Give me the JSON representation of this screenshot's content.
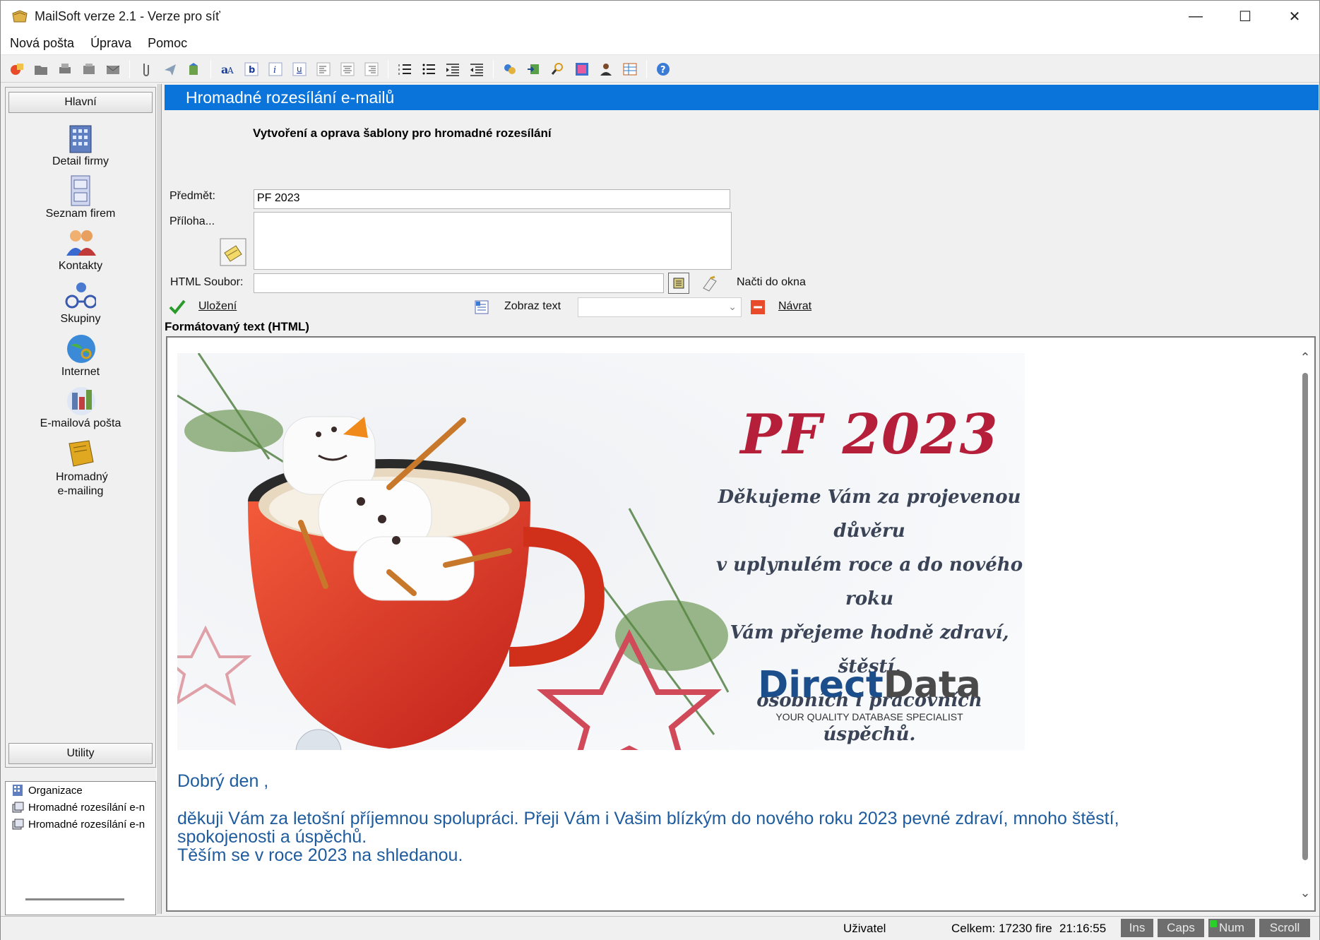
{
  "window": {
    "title": "MailSoft verze 2.1 - Verze pro síť",
    "minimize": "—",
    "maximize": "☐",
    "close": "✕"
  },
  "menu": {
    "items": [
      "Nová pošta",
      "Úprava",
      "Pomoc"
    ]
  },
  "toolbar": {
    "icons": [
      "new-mail-icon",
      "open-icon",
      "print-icon",
      "print-preview-icon",
      "mail-icon",
      "attach-icon",
      "send-icon",
      "export-icon",
      "font-icon",
      "bold-icon",
      "italic-icon",
      "underline-icon",
      "align-left-icon",
      "align-center-icon",
      "align-right-icon",
      "numbered-list-icon",
      "bullet-list-icon",
      "indent-icon",
      "outdent-icon",
      "color-icon",
      "import-icon",
      "search-icon",
      "image-icon",
      "user-icon",
      "table-icon",
      "help-icon"
    ]
  },
  "leftnav": {
    "group_main": "Hlavní",
    "group_utility": "Utility",
    "items": [
      {
        "label": "Detail firmy",
        "icon": "building-icon"
      },
      {
        "label": "Seznam firem",
        "icon": "cabinet-icon"
      },
      {
        "label": "Kontakty",
        "icon": "contacts-icon"
      },
      {
        "label": "Skupiny",
        "icon": "groups-icon"
      },
      {
        "label": "Internet",
        "icon": "globe-icon"
      },
      {
        "label": "E-mailová pošta",
        "icon": "email-icon"
      },
      {
        "label": "Hromadný e-mailing",
        "icon": "book-icon"
      }
    ]
  },
  "tree": {
    "items": [
      "Organizace",
      "Hromadné rozesílání e-n",
      "Hromadné rozesílání e-n"
    ]
  },
  "main": {
    "header": "Hromadné rozesílání e-mailů",
    "subheading": "Vytvoření a oprava šablony pro hromadné rozesílání",
    "subject_label": "Předmět:",
    "subject_value": "PF 2023",
    "attachment_label": "Příloha...",
    "html_file_label": "HTML Soubor:",
    "load_label": "Načti do okna",
    "save_label": "Uložení",
    "show_text_label": "Zobraz text",
    "back_label": "Návrat",
    "formatted_label": "Formátovaný text (HTML)"
  },
  "card": {
    "title": "PF 2023",
    "message_lines": [
      "Děkujeme Vám za projevenou důvěru",
      "v uplynulém roce a do nového roku",
      "Vám přejeme hodně zdraví, štěstí,",
      "osobních i pracovních úspěchů."
    ],
    "logo_part1": "Direct",
    "logo_part2": "Data",
    "tagline": "YOUR QUALITY DATABASE SPECIALIST"
  },
  "body_text": {
    "greeting": "Dobrý den ,",
    "line1": "děkuji Vám za letošní příjemnou spolupráci. Přeji Vám i Vašim blízkým do nového roku 2023 pevné zdraví, mnoho štěstí,",
    "line2": "spokojenosti a úspěchů.",
    "line3": "Těším se v roce 2023 na shledanou."
  },
  "status": {
    "user": "Uživatel",
    "total": "Celkem: 17230 fire",
    "time": "21:16:55",
    "ins": "Ins",
    "caps": "Caps",
    "num": "Num",
    "scroll": "Scroll"
  },
  "colors": {
    "header_blue": "#0a74da",
    "card_red": "#b51f3a",
    "text_blue": "#1f5c9e"
  }
}
